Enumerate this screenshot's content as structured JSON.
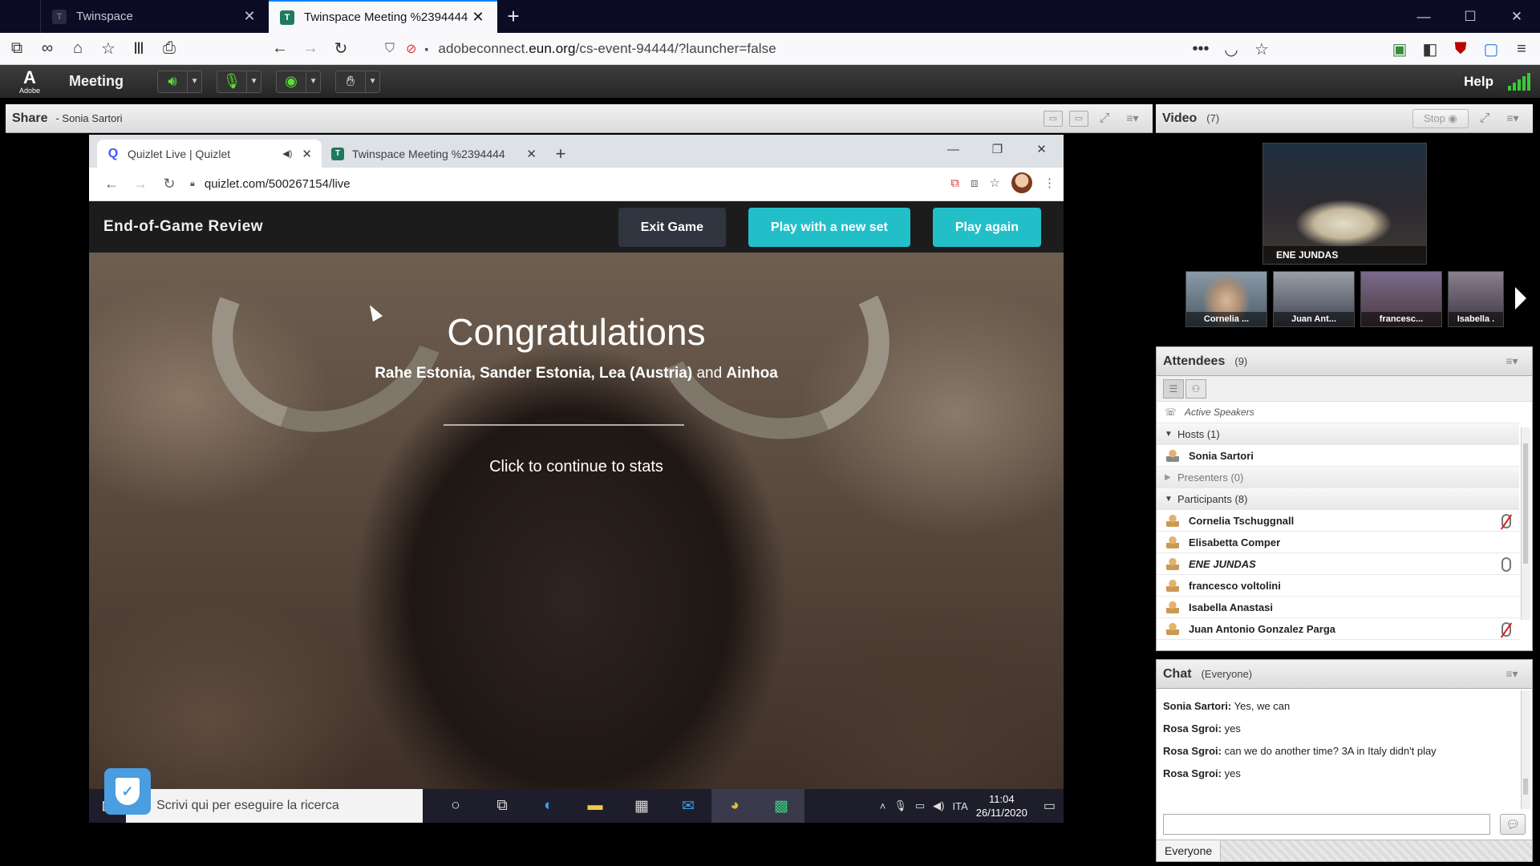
{
  "firefox": {
    "tabs": [
      {
        "label": "Twinspace",
        "favicon": "T"
      },
      {
        "label": "Twinspace Meeting %2394444",
        "favicon": "T"
      }
    ],
    "url_prefix": "adobeconnect.",
    "url_domain": "eun.org",
    "url_path": "/cs-event-94444/?launcher=false"
  },
  "adobe": {
    "logo_text": "Adobe",
    "menu_meeting": "Meeting",
    "help": "Help"
  },
  "share_pod": {
    "title": "Share",
    "presenter": "- Sonia Sartori"
  },
  "inner_chrome": {
    "tabs": [
      {
        "label": "Quizlet Live | Quizlet"
      },
      {
        "label": "Twinspace Meeting %2394444"
      }
    ],
    "url": "quizlet.com/500267154/live"
  },
  "quizlet": {
    "header_title": "End-of-Game Review",
    "exit_button": "Exit Game",
    "new_set_button": "Play with a new set",
    "play_again_button": "Play again",
    "congrats": "Congratulations",
    "winner_1": "Rahe Estonia,",
    "winner_2": "Sander Estonia,",
    "winner_3": "Lea (Austria)",
    "winner_and": "and",
    "winner_4": "Ainhoa",
    "continue_text": "Click to continue to stats"
  },
  "taskbar": {
    "search_placeholder": "Scrivi qui per eseguire la ricerca",
    "lang": "ITA",
    "time": "11:04",
    "date": "26/11/2020"
  },
  "video_pod": {
    "title": "Video",
    "count": "(7)",
    "stop": "Stop",
    "main_label": "ENE JUNDAS",
    "thumbs": [
      "Cornelia ...",
      "Juan Ant...",
      "francesc...",
      "Isabella ."
    ]
  },
  "attendees_pod": {
    "title": "Attendees",
    "count": "(9)",
    "active_speakers": "Active Speakers",
    "hosts_label": "Hosts (1)",
    "presenters_label": "Presenters (0)",
    "participants_label": "Participants (8)",
    "hosts": [
      "Sonia Sartori"
    ],
    "participants": [
      "Cornelia Tschuggnall",
      "Elisabetta Comper",
      "ENE JUNDAS",
      "francesco voltolini",
      "Isabella Anastasi",
      "Juan Antonio Gonzalez Parga"
    ]
  },
  "chat_pod": {
    "title": "Chat",
    "scope": "(Everyone)",
    "messages": [
      {
        "sender": "Sonia Sartori:",
        "text": "Yes, we can"
      },
      {
        "sender": "Rosa Sgroi:",
        "text": "yes"
      },
      {
        "sender": "Rosa Sgroi:",
        "text": "can we do another time? 3A in Italy didn't play"
      },
      {
        "sender": "Rosa Sgroi:",
        "text": "yes"
      }
    ],
    "target": "Everyone"
  },
  "colors": {
    "quizlet_teal": "#23bfc8",
    "firefox_accent": "#0a84ff",
    "adobe_green": "#5edc3a"
  }
}
